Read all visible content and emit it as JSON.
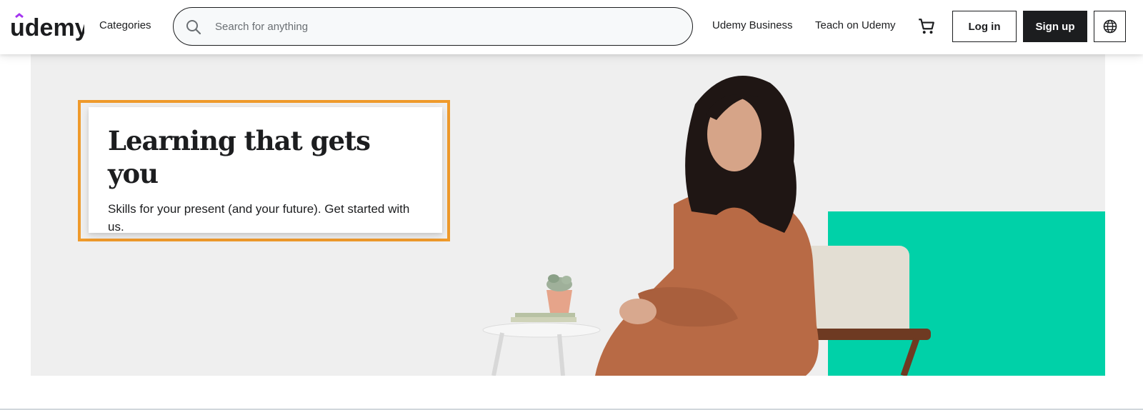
{
  "header": {
    "logo_text": "udemy",
    "categories_label": "Categories",
    "search": {
      "placeholder": "Search for anything",
      "value": ""
    },
    "business_label": "Udemy Business",
    "teach_label": "Teach on Udemy",
    "login_label": "Log in",
    "signup_label": "Sign up",
    "icons": {
      "search": "search-icon",
      "cart": "cart-icon",
      "language": "globe-icon"
    }
  },
  "hero": {
    "title": "Learning that gets you",
    "subtitle": "Skills for your present (and your future). Get started with us."
  },
  "colors": {
    "brand_purple": "#a435f0",
    "text_dark": "#1c1d1f",
    "hero_bg": "#efefef",
    "teal_accent": "#00d1a8",
    "highlight_orange": "#ef9a2b"
  }
}
